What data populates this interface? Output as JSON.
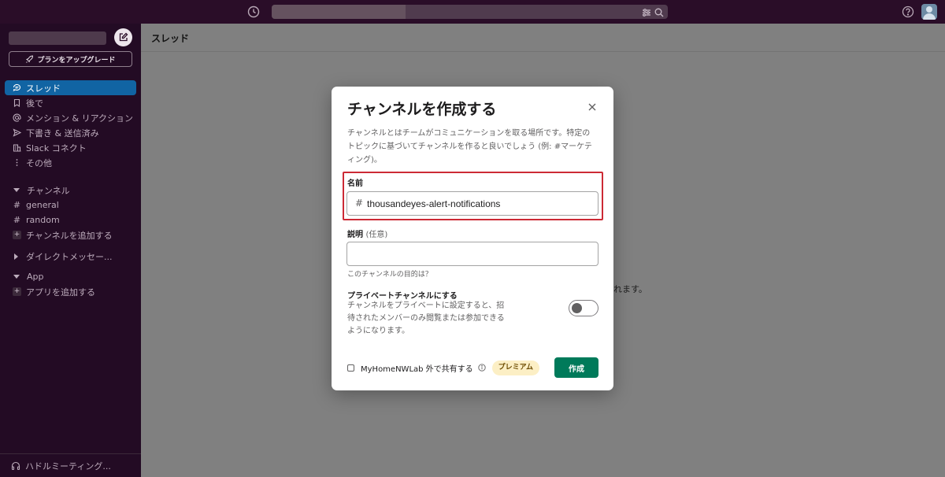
{
  "topbar": {
    "history_icon": "clock-icon",
    "filter_icon": "sliders-icon",
    "search_icon": "magnifier-icon",
    "help_icon": "question-circle-icon",
    "avatar_icon": "user-avatar-icon"
  },
  "sidebar": {
    "compose_icon": "compose-icon",
    "upgrade_label": "プランをアップグレード",
    "nav": [
      {
        "label": "スレッド",
        "icon": "threads-icon"
      },
      {
        "label": "後で",
        "icon": "bookmark-icon"
      },
      {
        "label": "メンション & リアクション",
        "icon": "at-icon"
      },
      {
        "label": "下書き & 送信済み",
        "icon": "send-icon"
      },
      {
        "label": "Slack コネクト",
        "icon": "building-icon"
      },
      {
        "label": "その他",
        "icon": "more-vertical-icon"
      }
    ],
    "channels_header": "チャンネル",
    "channels": [
      "general",
      "random"
    ],
    "add_channel": "チャンネルを追加する",
    "dm_header": "ダイレクトメッセー...",
    "app_header": "App",
    "add_app": "アプリを追加する",
    "huddle_label": "ハドルミーティング..."
  },
  "main": {
    "title": "スレッド",
    "background_text": "られます。"
  },
  "modal": {
    "title": "チャンネルを作成する",
    "description_line1": "チャンネルとはチームがコミュニケーションを取る場所です。特定の",
    "description_line2": "トピックに基づいてチャンネルを作ると良いでしょう (例: #マーケテ",
    "description_line3": "ィング)。",
    "name_label": "名前",
    "name_prefix": "#",
    "name_value": "thousandeyes-alert-notifications",
    "desc_label": "説明",
    "desc_optional": "(任意)",
    "desc_value": "",
    "desc_hint": "このチャンネルの目的は？",
    "private_title": "プライベートチャンネルにする",
    "private_desc_line1": "チャンネルをプライベートに設定すると、招",
    "private_desc_line2": "待されたメンバーのみ閲覧または参加できる",
    "private_desc_line3": "ようになります。",
    "private_enabled": false,
    "share_label": "MyHomeNWLab 外で共有する",
    "premium_badge": "プレミアム",
    "create_label": "作成"
  }
}
